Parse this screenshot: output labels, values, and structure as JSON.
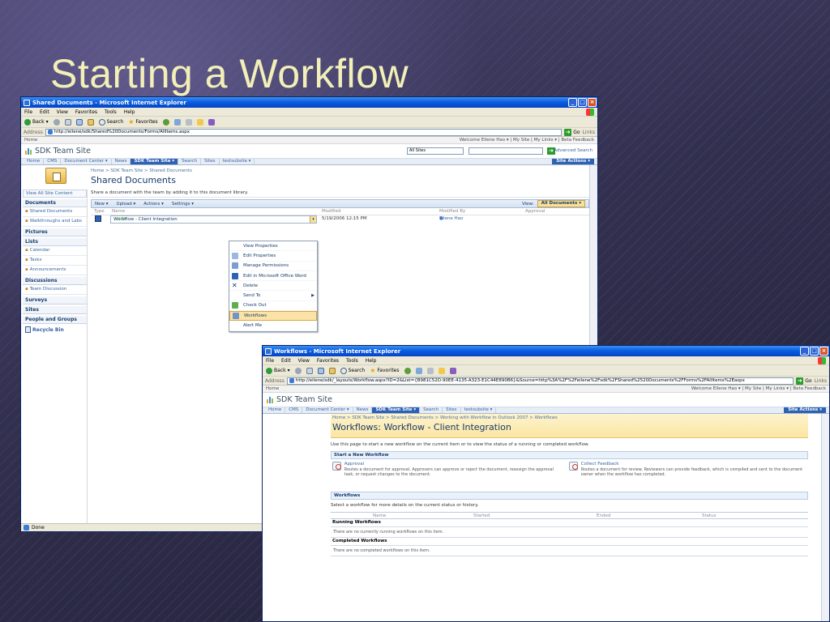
{
  "slide": {
    "title": "Starting a Workflow"
  },
  "ie_menu": [
    "File",
    "Edit",
    "View",
    "Favorites",
    "Tools",
    "Help"
  ],
  "ie_toolbar": {
    "back": "Back",
    "search": "Search",
    "favorites": "Favorites",
    "go": "Go",
    "links": "Links",
    "address_label": "Address"
  },
  "window1": {
    "title": "Shared Documents - Microsoft Internet Explorer",
    "address": "http://eilene/sdk/Shared%20Documents/Forms/AllItems.aspx",
    "top_left": "Home",
    "top_right": "Welcome Eilene Hao ▾  |  My Site  |  My Links ▾  |  Beta Feedback",
    "site_title": "SDK Team Site",
    "search_scope": "All Sites",
    "advanced_search": "Advanced Search",
    "nav": [
      "Home",
      "CMS",
      "Document Center ▾",
      "News",
      "SDK Team Site ▾",
      "Search",
      "Sites",
      "testsubsite ▾"
    ],
    "site_actions": "Site Actions ▾",
    "breadcrumb": "Home > SDK Team Site > Shared Documents",
    "page_title": "Shared Documents",
    "description": "Share a document with the team by adding it to this document library.",
    "toolbar": {
      "new": "New ▾",
      "upload": "Upload ▾",
      "actions": "Actions ▾",
      "settings": "Settings ▾",
      "view_label": "View:",
      "view_value": "All Documents"
    },
    "columns": {
      "type": "Type",
      "name": "Name",
      "modified": "Modified",
      "modified_by": "Modified By",
      "approval": "Approval"
    },
    "row": {
      "name": "Workflow - Client Integration",
      "new_tag": "! NEW",
      "modified": "5/19/2006 12:15 PM",
      "modified_by": "Eilene Hao"
    },
    "quicklaunch": {
      "view_all": "View All Site Content",
      "documents": "Documents",
      "documents_items": [
        "Shared Documents",
        "Walkthroughs and Labs"
      ],
      "pictures": "Pictures",
      "lists": "Lists",
      "lists_items": [
        "Calendar",
        "Tasks",
        "Announcements"
      ],
      "discussions": "Discussions",
      "discussions_items": [
        "Team Discussion"
      ],
      "surveys": "Surveys",
      "sites": "Sites",
      "people": "People and Groups",
      "recycle": "Recycle Bin"
    },
    "menu": [
      "View Properties",
      "Edit Properties",
      "Manage Permissions",
      "Edit in Microsoft Office Word",
      "Delete",
      "Send To",
      "Check Out",
      "Workflows",
      "Alert Me"
    ],
    "status": "Done"
  },
  "window2": {
    "title": "Workflows - Microsoft Internet Explorer",
    "address": "http://eilene/sdk/_layouts/Workflow.aspx?ID=2&List={B981C52D-90EE-4135-A323-E1C44E890B6}&Source=http%3A%2F%2Feilene%2Fsdk%2FShared%2520Documents%2FForms%2FAllItems%2Easpx",
    "top_left": "Home",
    "top_right": "Welcome Eilene Hao ▾  |  My Site  |  My Links ▾  |  Beta Feedback",
    "site_title": "SDK Team Site",
    "nav": [
      "Home",
      "CMS",
      "Document Center ▾",
      "News",
      "SDK Team Site ▾",
      "Search",
      "Sites",
      "testsubsite ▾"
    ],
    "site_actions": "Site Actions ▾",
    "breadcrumb": "Home > SDK Team Site > Shared Documents > Working with Workflow in Outlook 2007 > Workflows",
    "page_title": "Workflows: Workflow - Client Integration",
    "intro": "Use this page to start a new workflow on the current item or to view the status of a running or completed workflow.",
    "start_header": "Start a New Workflow",
    "approval": {
      "name": "Approval",
      "desc": "Routes a document for approval. Approvers can approve or reject the document, reassign the approval task, or request changes to the document."
    },
    "feedback": {
      "name": "Collect Feedback",
      "desc": "Routes a document for review. Reviewers can provide feedback, which is compiled and sent to the document owner when the workflow has completed."
    },
    "workflows_header": "Workflows",
    "select_text": "Select a workflow for more details on the current status or history.",
    "grid_cols": {
      "name": "Name",
      "started": "Started",
      "ended": "Ended",
      "status": "Status"
    },
    "running_header": "Running Workflows",
    "running_empty": "There are no currently running workflows on this item.",
    "completed_header": "Completed Workflows",
    "completed_empty": "There are no completed workflows on this item."
  },
  "colors": {
    "title_text": "#f2efb8",
    "xp_titlebar": "#0a5fe0",
    "sp_nav_active": "#2c61b4",
    "sp_highlight": "#fbe3a8"
  }
}
